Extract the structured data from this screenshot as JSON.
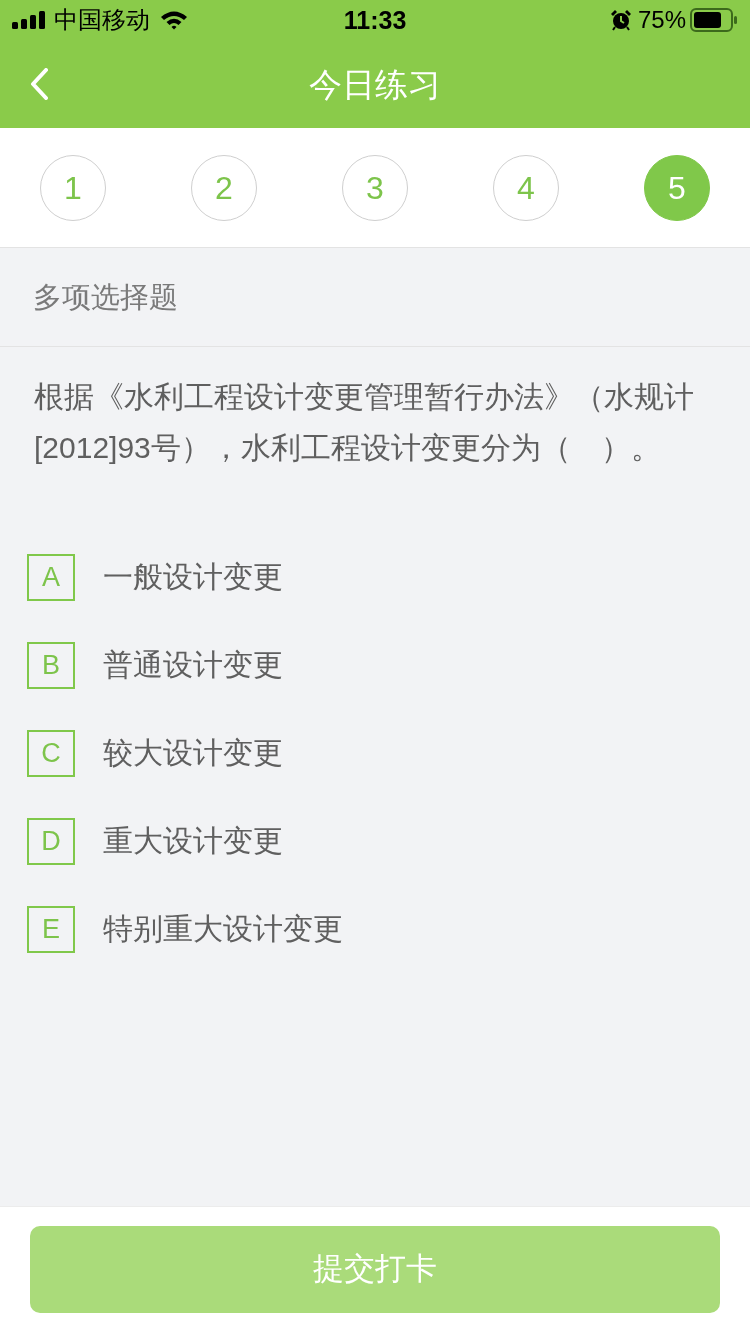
{
  "status_bar": {
    "carrier": "中国移动",
    "time": "11:33",
    "battery_percent": "75%"
  },
  "nav_bar": {
    "title": "今日练习"
  },
  "question_tabs": [
    {
      "label": "1",
      "selected": false
    },
    {
      "label": "2",
      "selected": false
    },
    {
      "label": "3",
      "selected": false
    },
    {
      "label": "4",
      "selected": false
    },
    {
      "label": "5",
      "selected": true
    }
  ],
  "section": {
    "title": "多项选择题"
  },
  "question": {
    "text": "根据《水利工程设计变更管理暂行办法》（水规计[2012]93号），水利工程设计变更分为（　）。"
  },
  "options": [
    {
      "letter": "A",
      "text": "一般设计变更",
      "selected": false
    },
    {
      "letter": "B",
      "text": "普通设计变更",
      "selected": false
    },
    {
      "letter": "C",
      "text": "较大设计变更",
      "selected": false
    },
    {
      "letter": "D",
      "text": "重大设计变更",
      "selected": false
    },
    {
      "letter": "E",
      "text": "特别重大设计变更",
      "selected": false
    }
  ],
  "submit_button": {
    "label": "提交打卡",
    "disabled": true
  }
}
